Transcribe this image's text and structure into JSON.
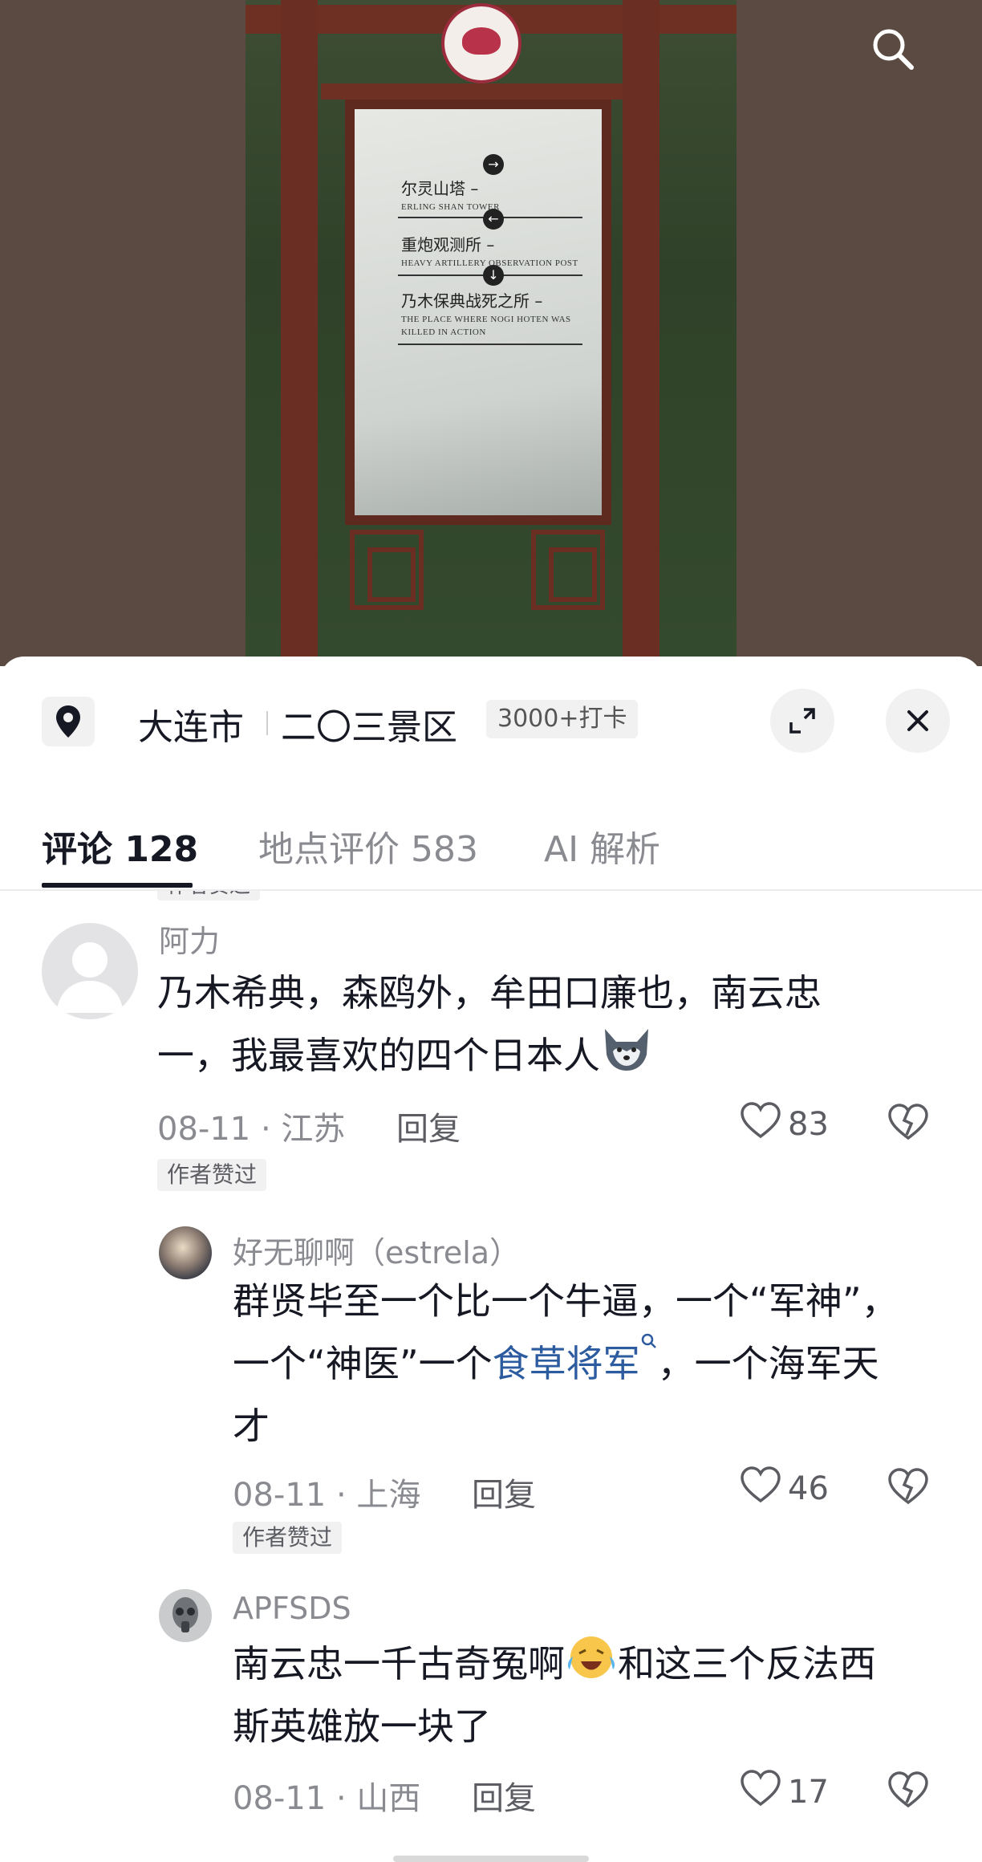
{
  "location": {
    "city": "大连市",
    "place": "二〇三景区",
    "checkins": "3000+打卡"
  },
  "sign": {
    "line1_cn": "尔灵山塔 –",
    "line1_en": "ERLING SHAN TOWER",
    "line2_cn": "重炮观测所 –",
    "line2_en": "HEAVY ARTILLERY OBSERVATION POST",
    "line3_cn": "乃木保典战死之所 –",
    "line3_en_a": "THE PLACE WHERE NOGI HOTEN WAS",
    "line3_en_b": "KILLED IN ACTION"
  },
  "tabs": [
    {
      "label": "评论 128"
    },
    {
      "label": "地点评价 583"
    },
    {
      "label": "AI 解析"
    }
  ],
  "clipped_badge": "作者赞过",
  "comments": [
    {
      "user": "阿力",
      "text_line1": "乃木希典，森鸥外，牟田口廉也，南云忠",
      "text_line2": "一，我最喜欢的四个日本人",
      "emoji_icon": "wolf-emoji",
      "date_region": "08-11 · 江苏",
      "reply": "回复",
      "likes": "83",
      "badge": "作者赞过"
    },
    {
      "user": "好无聊啊（estrela）",
      "text_line1": "群贤毕至一个比一个牛逼，一个“军神”，",
      "text_line2_a": "一个“神医”一个",
      "text_line2_link": "食草将军",
      "text_line2_b": "，一个海军天",
      "text_line3": "才",
      "date_region": "08-11 · 上海",
      "reply": "回复",
      "likes": "46",
      "badge": "作者赞过"
    },
    {
      "user": "APFSDS",
      "text_line1_a": "南云忠一千古奇冤啊",
      "emoji_icon": "crying-laughing-emoji",
      "text_line1_b": "和这三个反法西",
      "text_line2": "斯英雄放一块了",
      "date_region": "08-11 · 山西",
      "reply": "回复",
      "likes": "17"
    }
  ],
  "colors": {
    "link": "#2c5b9f",
    "muted": "#8a8b91",
    "text": "#161823"
  }
}
